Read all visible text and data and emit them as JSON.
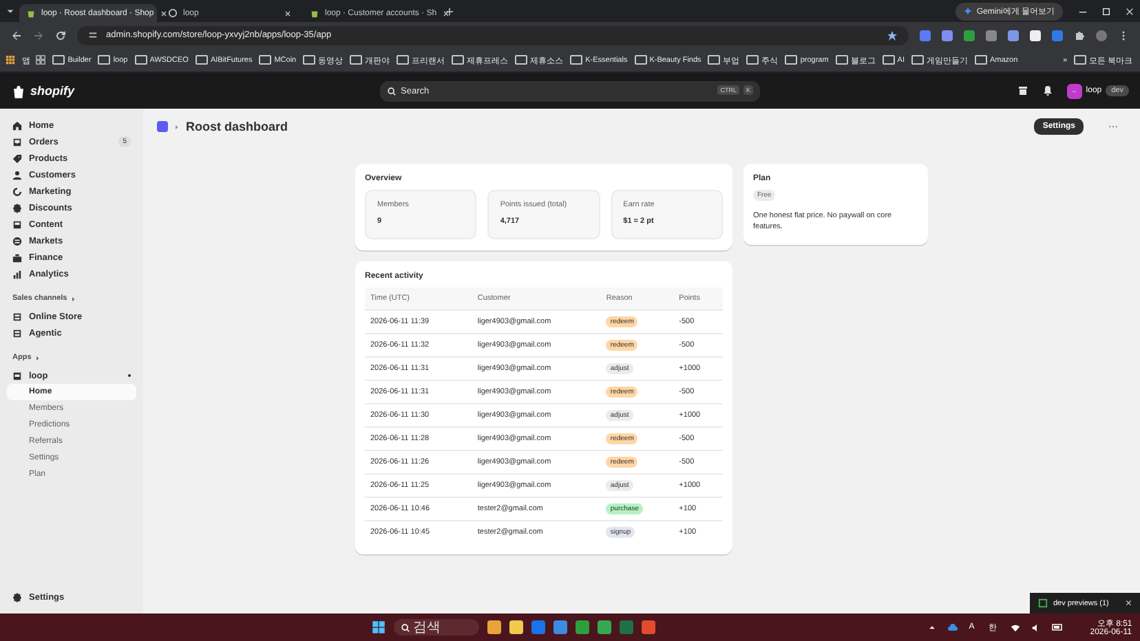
{
  "browser": {
    "tabs": [
      {
        "title": "loop · Roost dashboard · Shop",
        "selected": true
      },
      {
        "title": "loop",
        "selected": false
      },
      {
        "title": "loop · Customer accounts · Sh",
        "selected": false
      }
    ],
    "gemini_button": "Gemini에게 물어보기",
    "url": "admin.shopify.com/store/loop-yxvyj2nb/apps/loop-35/app",
    "bookmarks": [
      "앱",
      "Builder",
      "loop",
      "AWSDCEO",
      "AIBitFutures",
      "MCoin",
      "동영상",
      "개판야",
      "프리랜서",
      "제휴프레스",
      "제휴소스",
      "K-Essentials",
      "K-Beauty Finds",
      "부업",
      "주식",
      "program",
      "블로그",
      "AI",
      "게임만들기",
      "Amazon"
    ],
    "bookmarks_more": "»",
    "all_bookmarks": "모든 북마크"
  },
  "admin": {
    "logo": "shopify",
    "search": {
      "placeholder": "Search",
      "keys": [
        "CTRL",
        "K"
      ]
    },
    "store_avatar": "..",
    "store": "loop",
    "env_badge": "dev"
  },
  "sidebar": {
    "items": [
      {
        "label": "Home"
      },
      {
        "label": "Orders",
        "badge": "5"
      },
      {
        "label": "Products"
      },
      {
        "label": "Customers"
      },
      {
        "label": "Marketing"
      },
      {
        "label": "Discounts"
      },
      {
        "label": "Content"
      },
      {
        "label": "Markets"
      },
      {
        "label": "Finance"
      },
      {
        "label": "Analytics"
      }
    ],
    "sales_channels": {
      "label": "Sales channels",
      "items": [
        "Online Store",
        "Agentic"
      ]
    },
    "apps": {
      "label": "Apps",
      "app": {
        "name": "loop",
        "children": [
          {
            "label": "Home",
            "selected": true
          },
          {
            "label": "Members",
            "selected": false
          },
          {
            "label": "Predictions",
            "selected": false
          },
          {
            "label": "Referrals",
            "selected": false
          },
          {
            "label": "Settings",
            "selected": false
          },
          {
            "label": "Plan",
            "selected": false
          }
        ]
      }
    },
    "settings": "Settings"
  },
  "page": {
    "title": "Roost dashboard",
    "settings_button": "Settings",
    "more_button": "···"
  },
  "overview": {
    "title": "Overview",
    "stats": [
      {
        "label": "Members",
        "value": "9"
      },
      {
        "label": "Points issued (total)",
        "value": "4,717"
      },
      {
        "label": "Earn rate",
        "value": "$1 = 2 pt"
      }
    ]
  },
  "plan": {
    "title": "Plan",
    "badge": "Free",
    "description": "One honest flat price. No paywall on core features."
  },
  "activity": {
    "title": "Recent activity",
    "columns": [
      "Time (UTC)",
      "Customer",
      "Reason",
      "Points"
    ],
    "rows": [
      {
        "time": "2026-06-11 11:39",
        "customer": "liger4903@gmail.com",
        "reason": "redeem",
        "color": "#ffd6a4",
        "points": "-500"
      },
      {
        "time": "2026-06-11 11:32",
        "customer": "liger4903@gmail.com",
        "reason": "redeem",
        "color": "#ffd6a4",
        "points": "-500"
      },
      {
        "time": "2026-06-11 11:31",
        "customer": "liger4903@gmail.com",
        "reason": "adjust",
        "color": "#ebebeb",
        "points": "+1000"
      },
      {
        "time": "2026-06-11 11:31",
        "customer": "liger4903@gmail.com",
        "reason": "redeem",
        "color": "#ffd6a4",
        "points": "-500"
      },
      {
        "time": "2026-06-11 11:30",
        "customer": "liger4903@gmail.com",
        "reason": "adjust",
        "color": "#ebebeb",
        "points": "+1000"
      },
      {
        "time": "2026-06-11 11:28",
        "customer": "liger4903@gmail.com",
        "reason": "redeem",
        "color": "#ffd6a4",
        "points": "-500"
      },
      {
        "time": "2026-06-11 11:26",
        "customer": "liger4903@gmail.com",
        "reason": "redeem",
        "color": "#ffd6a4",
        "points": "-500"
      },
      {
        "time": "2026-06-11 11:25",
        "customer": "liger4903@gmail.com",
        "reason": "adjust",
        "color": "#ebebeb",
        "points": "+1000"
      },
      {
        "time": "2026-06-11 10:46",
        "customer": "tester2@gmail.com",
        "reason": "purchase",
        "color": "#b4f2c4",
        "points": "+100"
      },
      {
        "time": "2026-06-11 10:45",
        "customer": "tester2@gmail.com",
        "reason": "signup",
        "color": "#e3e6ee",
        "points": "+100"
      }
    ]
  },
  "notification": {
    "title": "dev previews (1)",
    "close": "×"
  },
  "taskbar": {
    "search": {
      "placeholder": "검색"
    },
    "tray": {
      "font": "A",
      "ime": "한",
      "time": "오후 8:51",
      "date": "2026-06-11"
    }
  }
}
